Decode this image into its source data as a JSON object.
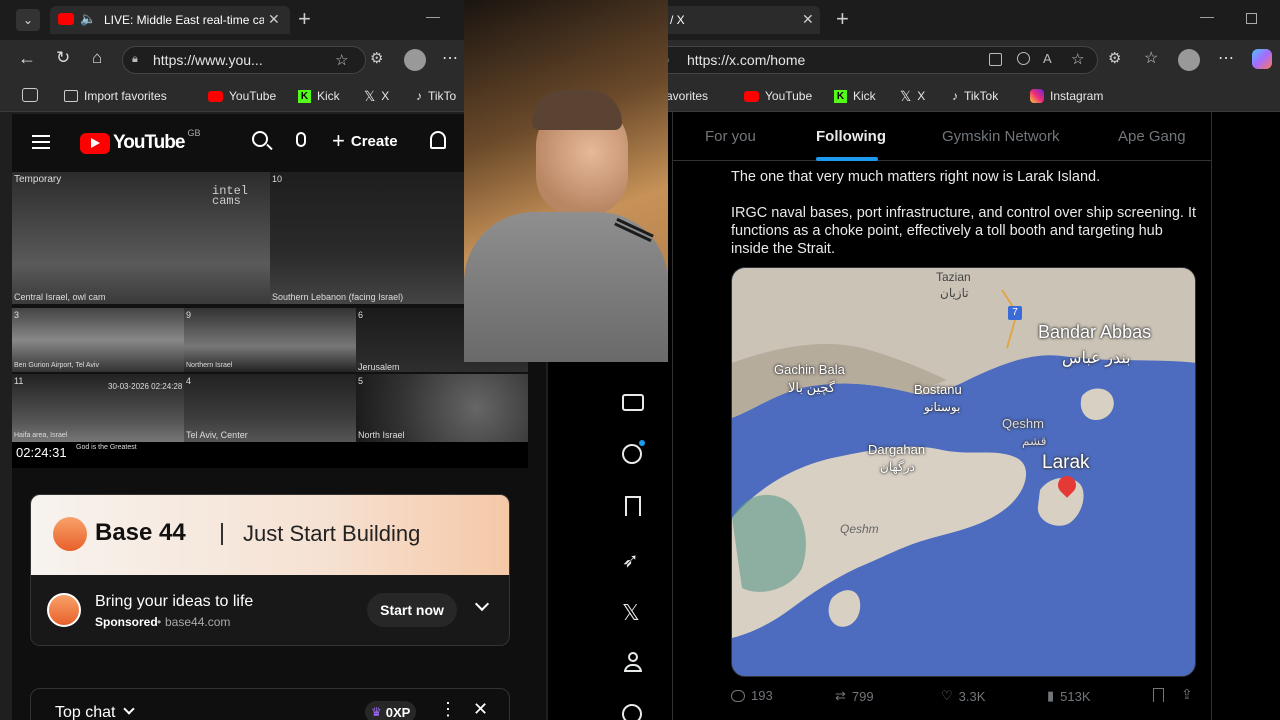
{
  "left_browser": {
    "tab_title": "LIVE: Middle East real-time ca",
    "url": "https://www.you...",
    "favorites": [
      "Import favorites",
      "YouTube",
      "Kick",
      "X",
      "TikTo"
    ]
  },
  "youtube": {
    "logo_text": "YouTube",
    "region": "GB",
    "create_label": "Create",
    "video": {
      "temporary": "Temporary",
      "watermark": "intel cams",
      "cells": [
        {
          "num": "",
          "label": "Central Israel, owl cam"
        },
        {
          "num": "10",
          "label": "Southern Lebanon (facing Israel)"
        },
        {
          "num": "3",
          "label": "Ben Gurion Airport, Tel Aviv"
        },
        {
          "num": "9",
          "label": "Northern Israel"
        },
        {
          "num": "6",
          "label": "Jerusalem"
        },
        {
          "num": "11",
          "label": "Haifa area, Israel"
        },
        {
          "num": "4",
          "label": "Tel Aviv, Center"
        },
        {
          "num": "5",
          "label": "North Israel"
        }
      ],
      "cell_time": "30-03-2026 02:24:28",
      "clock": "02:24:31",
      "ticker": "God is the Greatest"
    },
    "ad": {
      "brand": "Base 44",
      "slogan": "Just Start Building",
      "headline": "Bring your ideas to life",
      "sponsored": "Sponsored",
      "domain": "base44.com",
      "cta": "Start now"
    },
    "chat": {
      "title": "Top chat",
      "xp": "0XP"
    }
  },
  "right_browser": {
    "tab_title": "/ X",
    "url": "https://x.com/home",
    "favorites": [
      "avorites",
      "YouTube",
      "Kick",
      "X",
      "TikTok",
      "Instagram"
    ]
  },
  "x": {
    "tabs": [
      "For you",
      "Following",
      "Gymskin Network",
      "Ape Gang"
    ],
    "active_tab": "Following",
    "tweet_p1": "The one that very much matters right now is Larak Island.",
    "tweet_p2": "IRGC naval bases, port infrastructure, and control over ship screening. It functions as a choke point, effectively a toll booth and targeting hub inside the Strait.",
    "map_labels": {
      "tazian": "Tazian",
      "tazian_fa": "تازیان",
      "bandar": "Bandar Abbas",
      "bandar_fa": "بندر عباس",
      "gachin": "Gachin Bala",
      "gachin_fa": "گچین بالا",
      "bostanu": "Bostanu",
      "bostanu_fa": "بوستانو",
      "qeshm_city": "Qeshm",
      "qeshm_fa": "قشم",
      "dargahan": "Dargahan",
      "dargahan_fa": "درگهان",
      "larak": "Larak",
      "qeshm_island": "Qeshm",
      "road": "7"
    },
    "stats": {
      "replies": "193",
      "reposts": "799",
      "likes": "3.3K",
      "views": "513K"
    }
  },
  "colors": {
    "youtube_red": "#ff0000",
    "kick_green": "#53fc18",
    "x_blue": "#1d9bf0",
    "sea": "#4d6cbf"
  }
}
